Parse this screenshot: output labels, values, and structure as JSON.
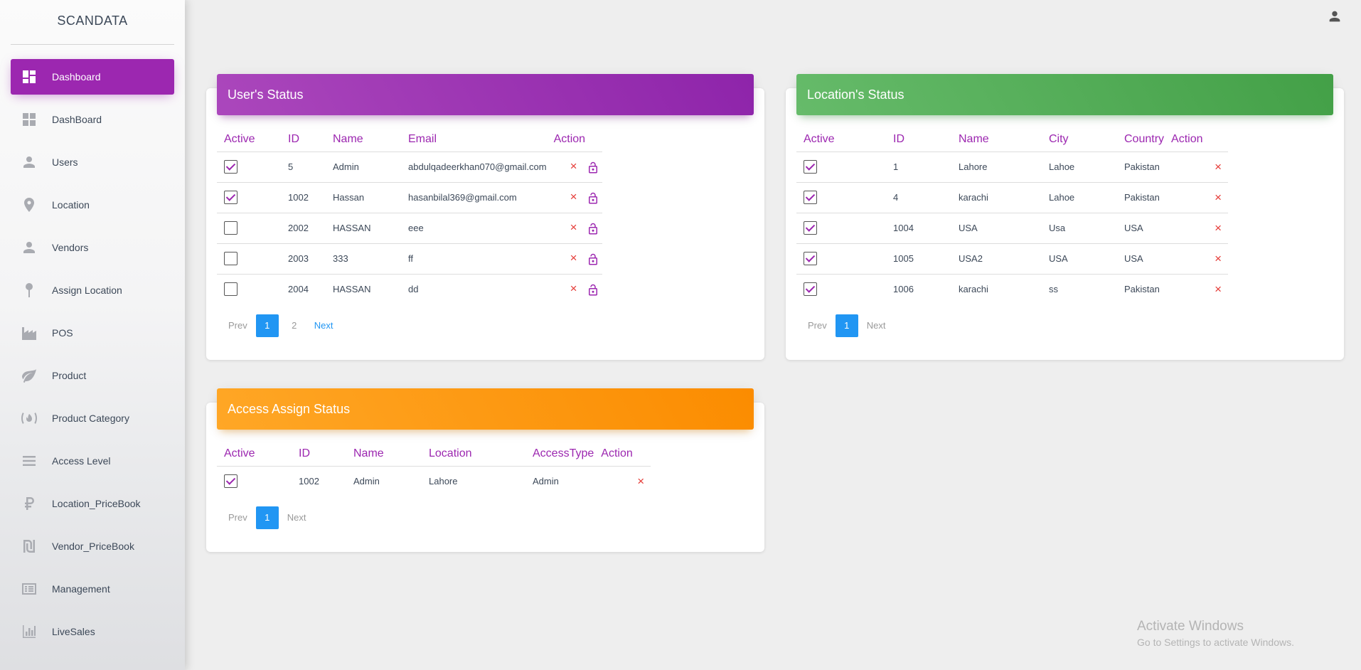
{
  "sidebar": {
    "brand": "SCANDATA",
    "items": [
      {
        "label": "Dashboard",
        "icon": "dashboard-icon"
      },
      {
        "label": "DashBoard",
        "icon": "grid-icon"
      },
      {
        "label": "Users",
        "icon": "person-icon"
      },
      {
        "label": "Location",
        "icon": "location-pin-icon"
      },
      {
        "label": "Vendors",
        "icon": "person-icon"
      },
      {
        "label": "Assign Location",
        "icon": "pin-icon"
      },
      {
        "label": "POS",
        "icon": "factory-icon"
      },
      {
        "label": "Product",
        "icon": "leaf-icon"
      },
      {
        "label": "Product Category",
        "icon": "fire-icon"
      },
      {
        "label": "Access Level",
        "icon": "menu-lines-icon"
      },
      {
        "label": "Location_PriceBook",
        "icon": "ruble-icon"
      },
      {
        "label": "Vendor_PriceBook",
        "icon": "shekel-icon"
      },
      {
        "label": "Management",
        "icon": "list-alt-icon"
      },
      {
        "label": "LiveSales",
        "icon": "bar-chart-icon"
      }
    ]
  },
  "users_card": {
    "title": "User's Status",
    "headers": [
      "Active",
      "ID",
      "Name",
      "Email",
      "Action"
    ],
    "rows": [
      {
        "active": true,
        "id": "5",
        "name": "Admin",
        "email": "abdulqadeerkhan070@gmail.com"
      },
      {
        "active": true,
        "id": "1002",
        "name": "Hassan",
        "email": "hasanbilal369@gmail.com"
      },
      {
        "active": false,
        "id": "2002",
        "name": "HASSAN",
        "email": "eee"
      },
      {
        "active": false,
        "id": "2003",
        "name": "333",
        "email": "ff"
      },
      {
        "active": false,
        "id": "2004",
        "name": "HASSAN",
        "email": "dd"
      }
    ],
    "pager": {
      "prev": "Prev",
      "pages": [
        "1",
        "2"
      ],
      "next": "Next"
    }
  },
  "location_card": {
    "title": "Location's Status",
    "headers": [
      "Active",
      "ID",
      "Name",
      "City",
      "Country",
      "Action"
    ],
    "rows": [
      {
        "active": true,
        "id": "1",
        "name": "Lahore",
        "city": "Lahoe",
        "country": "Pakistan"
      },
      {
        "active": true,
        "id": "4",
        "name": "karachi",
        "city": "Lahoe",
        "country": "Pakistan"
      },
      {
        "active": true,
        "id": "1004",
        "name": "USA",
        "city": "Usa",
        "country": "USA"
      },
      {
        "active": true,
        "id": "1005",
        "name": "USA2",
        "city": "USA",
        "country": "USA"
      },
      {
        "active": true,
        "id": "1006",
        "name": "karachi",
        "city": "ss",
        "country": "Pakistan"
      }
    ],
    "pager": {
      "prev": "Prev",
      "pages": [
        "1"
      ],
      "next": "Next"
    }
  },
  "access_card": {
    "title": "Access Assign Status",
    "headers": [
      "Active",
      "ID",
      "Name",
      "Location",
      "AccessType",
      "Action"
    ],
    "rows": [
      {
        "active": true,
        "id": "1002",
        "name": "Admin",
        "location": "Lahore",
        "access_type": "Admin"
      }
    ],
    "pager": {
      "prev": "Prev",
      "pages": [
        "1"
      ],
      "next": "Next"
    }
  },
  "icons": {
    "delete": "×",
    "account": "account-icon",
    "unlock": "unlock-icon"
  },
  "colors": {
    "primary": "#9c27b0",
    "success": "#4caf50",
    "warning": "#ff9800",
    "info": "#2196f3",
    "danger": "#e53935"
  },
  "watermark": {
    "line1": "Activate Windows",
    "line2": "Go to Settings to activate Windows."
  }
}
